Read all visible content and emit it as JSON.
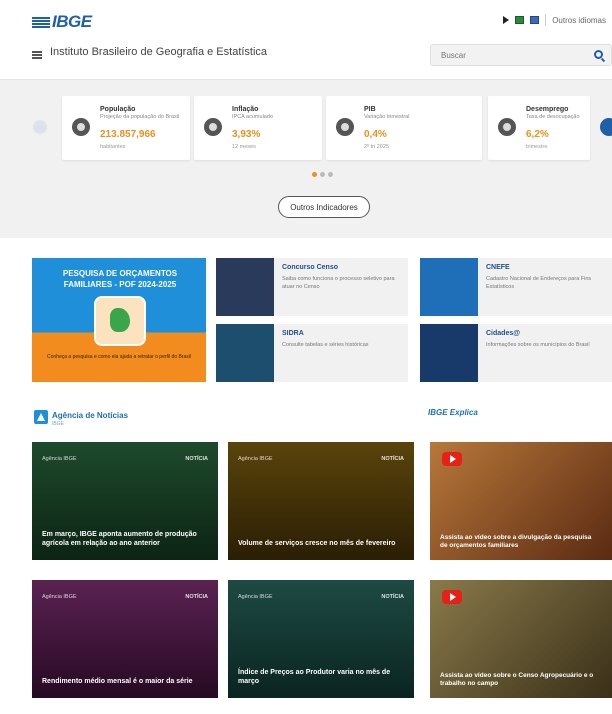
{
  "header": {
    "logo": "IBGE",
    "institute_name": "Instituto Brasileiro de Geografia e Estatística",
    "search_placeholder": "Buscar",
    "lang_label": "Outros idiomas"
  },
  "indicators": [
    {
      "title": "População",
      "subtitle": "Projeção da população do Brasil",
      "value": "213.857,966",
      "note": "habitantes"
    },
    {
      "title": "Inflação",
      "subtitle": "IPCA acumulado",
      "value": "3,93%",
      "note": "12 meses"
    },
    {
      "title": "PIB",
      "subtitle": "Variação trimestral",
      "value": "0,4%",
      "note": "2º tri 2025"
    },
    {
      "title": "Desemprego",
      "subtitle": "Taxa de desocupação",
      "value": "6,2%",
      "note": "trimestre"
    }
  ],
  "more_indicators_label": "Outros Indicadores",
  "featured": {
    "title": "PESQUISA DE ORÇAMENTOS FAMILIARES - POF 2024-2025",
    "caption": "Conheça a pesquisa e como ela ajuda a retratar o perfil do Brasil"
  },
  "side_news": [
    {
      "title": "Concurso Censo",
      "desc": "Saiba como funciona o processo seletivo para atuar no Censo"
    },
    {
      "title": "CNEFE",
      "desc": "Cadastro Nacional de Endereços para Fins Estatísticos"
    },
    {
      "title": "SIDRA",
      "desc": "Consulte tabelas e séries históricas"
    },
    {
      "title": "Cidades@",
      "desc": "Informações sobre os municípios do Brasil"
    }
  ],
  "section": {
    "title": "Agência de Notícias",
    "subtitle": "IBGE",
    "explica": "IBGE Explica"
  },
  "news": [
    {
      "tag": "Agência IBGE",
      "type": "NOTÍCIA",
      "headline": "Em março, IBGE aponta aumento de produção agrícola em relação ao ano anterior",
      "color": "#1e4a2c"
    },
    {
      "tag": "Agência IBGE",
      "type": "NOTÍCIA",
      "headline": "Volume de serviços cresce no mês de fevereiro",
      "color": "#4a3a0c"
    },
    {
      "tag": "Agência IBGE",
      "type": "NOTÍCIA",
      "headline": "Rendimento médio mensal é o maior da série",
      "color": "#4a1a42"
    },
    {
      "tag": "Agência IBGE",
      "type": "NOTÍCIA",
      "headline": "Índice de Preços ao Produtor varia no mês de março",
      "color": "#1a3a34"
    }
  ],
  "videos": [
    {
      "title": "Assista ao vídeo sobre a divulgação da pesquisa de orçamentos familiares",
      "color": "#6a3418"
    },
    {
      "title": "Assista ao vídeo sobre o Censo Agropecuário e o trabalho no campo",
      "color": "#5a4a22"
    }
  ]
}
